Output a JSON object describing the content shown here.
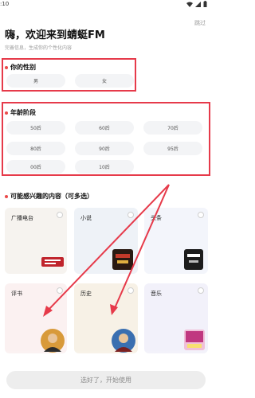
{
  "status_bar": {
    "time": ":10"
  },
  "skip_label": "跳过",
  "title": "嗨，欢迎来到蜻蜓FM",
  "subtitle": "完善信息，生成你的个性化内容",
  "gender": {
    "title": "你的性别",
    "options": [
      "男",
      "女"
    ]
  },
  "age": {
    "title": "年龄阶段",
    "options": [
      "50后",
      "60后",
      "70后",
      "80后",
      "90后",
      "95后",
      "00后",
      "10后"
    ]
  },
  "interests": {
    "title": "可能感兴趣的内容（可多选）",
    "cards": [
      {
        "label": "广播电台",
        "bg": "#f6f3ef"
      },
      {
        "label": "小说",
        "bg": "#eef2f7"
      },
      {
        "label": "头条",
        "bg": "#f3f5fb"
      },
      {
        "label": "评书",
        "bg": "#fbf1f1"
      },
      {
        "label": "历史",
        "bg": "#f7f1e6"
      },
      {
        "label": "音乐",
        "bg": "#f2f1fa"
      }
    ]
  },
  "start_button": "选好了，开始使用",
  "colors": {
    "accent_red": "#e63a4a",
    "pill_bg": "#f3f4f6"
  }
}
